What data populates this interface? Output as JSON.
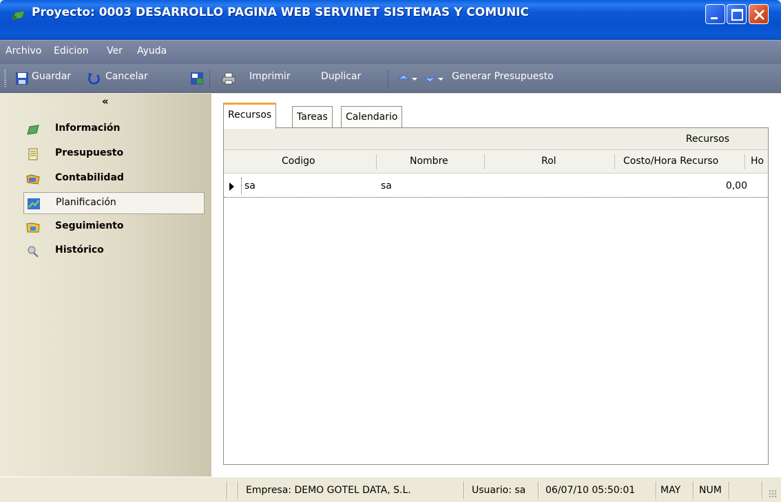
{
  "window": {
    "title": "Proyecto: 0003 DESARROLLO PAGINA WEB SERVINET SISTEMAS Y COMUNIC"
  },
  "menu": {
    "items": [
      "Archivo",
      "Edicion",
      "Ver",
      "Ayuda"
    ]
  },
  "toolbar": {
    "save_label": "Guardar",
    "cancel_label": "Cancelar",
    "print_label": "Imprimir",
    "duplicate_label": "Duplicar",
    "generate_label": "Generar Presupuesto"
  },
  "sidebar": {
    "collapse_label": "«",
    "items": [
      {
        "label": "Información",
        "icon": "info-icon"
      },
      {
        "label": "Presupuesto",
        "icon": "document-icon"
      },
      {
        "label": "Contabilidad",
        "icon": "folder-icon"
      },
      {
        "label": "Planificación",
        "icon": "chart-icon",
        "active": true
      },
      {
        "label": "Seguimiento",
        "icon": "tracking-icon"
      },
      {
        "label": "Histórico",
        "icon": "history-icon"
      }
    ]
  },
  "tabs": [
    {
      "label": "Recursos",
      "active": true
    },
    {
      "label": "Tareas"
    },
    {
      "label": "Calendario"
    }
  ],
  "grid": {
    "band_label": "Recursos",
    "columns": [
      "Codigo",
      "Nombre",
      "Rol",
      "Costo/Hora Recurso",
      "Ho"
    ],
    "rows": [
      {
        "codigo": "sa",
        "nombre": "sa",
        "rol": "",
        "costo": "0,00"
      }
    ]
  },
  "status": {
    "empresa": "Empresa: DEMO GOTEL DATA, S.L.",
    "usuario": "Usuario: sa",
    "datetime": "06/07/10 05:50:01",
    "caps": "MAY",
    "num": "NUM"
  },
  "colors": {
    "titlebar": "#0a58d6",
    "toolbar": "#6a7691",
    "tab_accent": "#f2a63a"
  }
}
